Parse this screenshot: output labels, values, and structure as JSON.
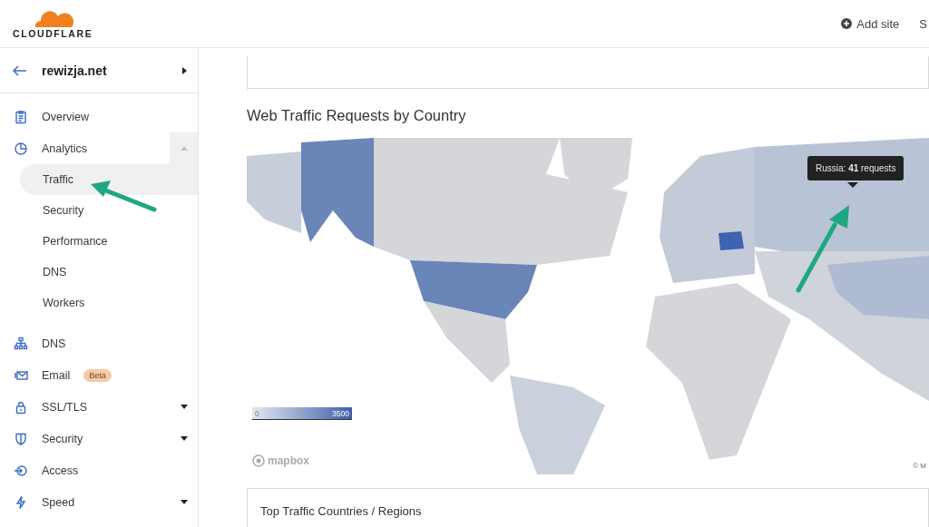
{
  "header": {
    "logo": "CLOUDFLARE",
    "actions": [
      {
        "label": "Add site"
      },
      {
        "label": "S"
      }
    ]
  },
  "sidebar": {
    "site": "rewizja.net",
    "items": [
      {
        "label": "Overview"
      },
      {
        "label": "Analytics",
        "expanded": true,
        "children": [
          {
            "label": "Traffic",
            "selected": true
          },
          {
            "label": "Security",
            "selected": false
          },
          {
            "label": "Performance",
            "selected": false
          },
          {
            "label": "DNS",
            "selected": false
          },
          {
            "label": "Workers",
            "selected": false
          }
        ]
      },
      {
        "label": "DNS"
      },
      {
        "label": "Email",
        "badge": "Beta"
      },
      {
        "label": "SSL/TLS",
        "expanded": false
      },
      {
        "label": "Security",
        "expanded": false
      },
      {
        "label": "Access"
      },
      {
        "label": "Speed",
        "expanded": false
      }
    ]
  },
  "map_section": {
    "title": "Web Traffic Requests by Country",
    "tooltip": "Russia: **41** requests",
    "legend": {
      "min": "0",
      "max": "3500"
    },
    "attribution": "mapbox",
    "copyright": "© M"
  },
  "bottom_card": {
    "title": "Top Traffic Countries / Regions"
  }
}
